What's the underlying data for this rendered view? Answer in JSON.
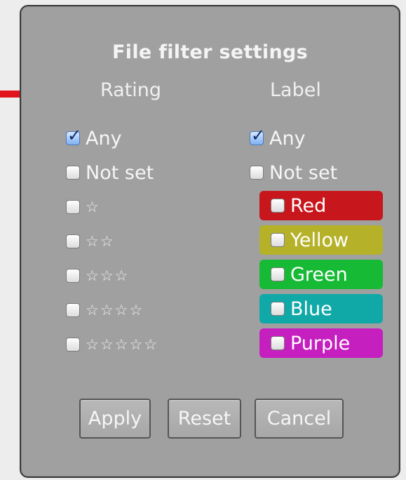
{
  "title": "File filter settings",
  "columns": {
    "rating": "Rating",
    "label": "Label"
  },
  "rating_options": [
    {
      "label": "Any",
      "checked": true
    },
    {
      "label": "Not set",
      "checked": false
    },
    {
      "stars": "☆",
      "checked": false
    },
    {
      "stars": "☆☆",
      "checked": false
    },
    {
      "stars": "☆☆☆",
      "checked": false
    },
    {
      "stars": "☆☆☆☆",
      "checked": false
    },
    {
      "stars": "☆☆☆☆☆",
      "checked": false
    }
  ],
  "label_options": [
    {
      "label": "Any",
      "checked": true
    },
    {
      "label": "Not set",
      "checked": false
    },
    {
      "label": "Red",
      "color": "#c8161d",
      "checked": false
    },
    {
      "label": "Yellow",
      "color": "#b5b22a",
      "checked": false
    },
    {
      "label": "Green",
      "color": "#16ba35",
      "checked": false
    },
    {
      "label": "Blue",
      "color": "#11a9a7",
      "checked": false
    },
    {
      "label": "Purple",
      "color": "#c51fbf",
      "checked": false
    }
  ],
  "buttons": {
    "apply": "Apply",
    "reset": "Reset",
    "cancel": "Cancel"
  },
  "colors": {
    "panel_bg": "#a0a0a0",
    "arrow": "#e0141a"
  }
}
